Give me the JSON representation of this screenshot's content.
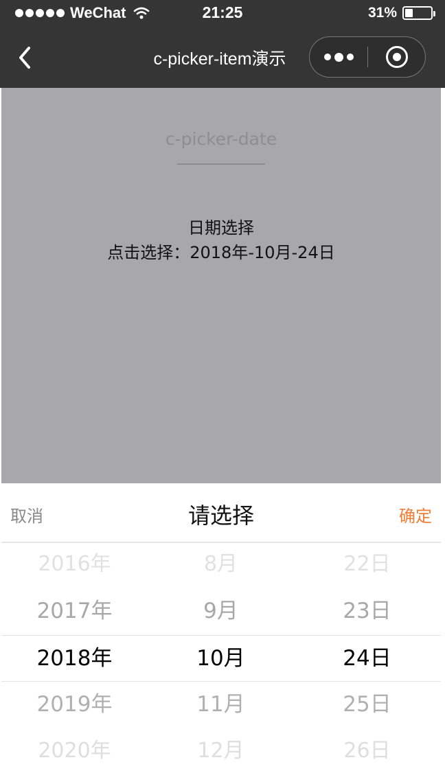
{
  "status_bar": {
    "carrier": "WeChat",
    "time": "21:25",
    "battery_percent_label": "31%",
    "battery_level": 0.31,
    "signal_dots": 5,
    "wifi_icon": "wifi-icon"
  },
  "nav_bar": {
    "title": "c-picker-item演示",
    "back_icon": "back-chevron-icon",
    "more_icon": "more-dots-icon",
    "close_icon": "target-circle-icon"
  },
  "page": {
    "section_title": "c-picker-date",
    "demo_label": "日期选择",
    "demo_value": "点击选择：2018年-10月-24日"
  },
  "picker": {
    "cancel_label": "取消",
    "title": "请选择",
    "confirm_label": "确定",
    "columns": [
      {
        "name": "year",
        "options": [
          "2016年",
          "2017年",
          "2018年",
          "2019年",
          "2020年"
        ],
        "selected_index": 2
      },
      {
        "name": "month",
        "options": [
          "8月",
          "9月",
          "10月",
          "11月",
          "12月"
        ],
        "selected_index": 2
      },
      {
        "name": "day",
        "options": [
          "22日",
          "23日",
          "24日",
          "25日",
          "26日"
        ],
        "selected_index": 2
      }
    ]
  },
  "colors": {
    "nav_background": "#353535",
    "mask": "#a8a8aa",
    "confirm_accent": "#f07d33"
  }
}
